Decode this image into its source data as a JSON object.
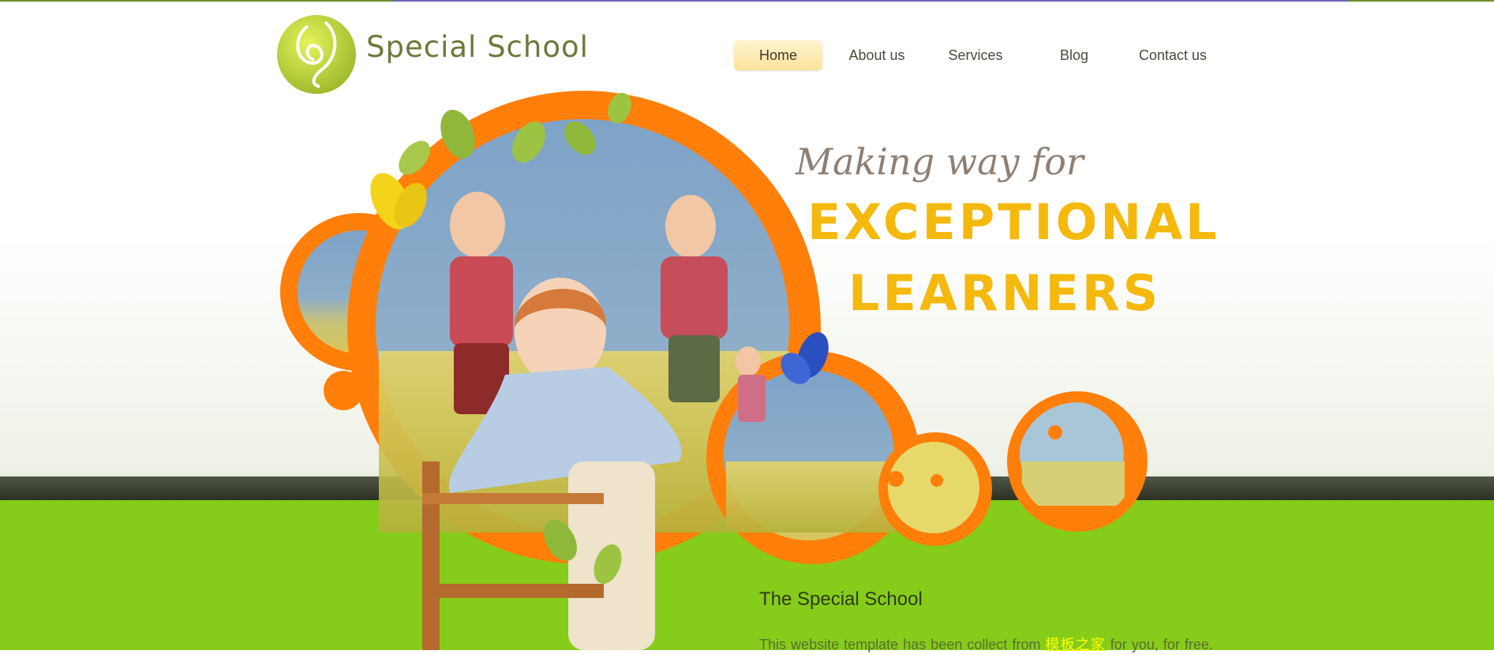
{
  "brand": {
    "name": "Special School",
    "logo_icon": "leaf-swirl-logo"
  },
  "nav": {
    "items": [
      {
        "label": "Home",
        "active": true
      },
      {
        "label": "About us",
        "active": false
      },
      {
        "label": "Services",
        "active": false
      },
      {
        "label": "Blog",
        "active": false
      },
      {
        "label": "Contact us",
        "active": false
      }
    ]
  },
  "hero": {
    "line1": "Making way for",
    "line2": "EXCEPTIONAL",
    "line3": "LEARNERS",
    "image_icon": "children-playing-hero-image"
  },
  "content": {
    "title": "The Special School",
    "text_before": "This website template has been collect from ",
    "link_text": "模板之家",
    "text_after": " for you, for free."
  },
  "colors": {
    "accent_orange": "#ff7f0a",
    "accent_yellow": "#f4b90c",
    "green": "#86cc1b",
    "nav_active": "#fbe39c"
  }
}
